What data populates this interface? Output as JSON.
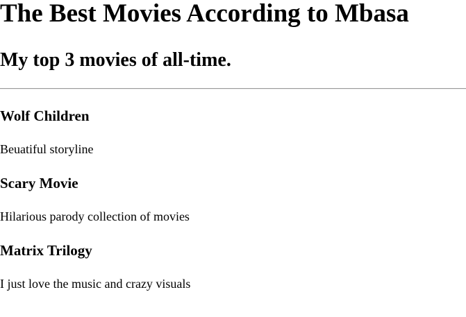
{
  "page": {
    "title": "The Best Movies According to Mbasa",
    "subtitle": "My top 3 movies of all-time."
  },
  "movies": [
    {
      "title": "Wolf Children",
      "description": "Beuatiful storyline"
    },
    {
      "title": "Scary Movie",
      "description": "Hilarious parody collection of movies"
    },
    {
      "title": "Matrix Trilogy",
      "description": "I just love the music and crazy visuals"
    }
  ]
}
